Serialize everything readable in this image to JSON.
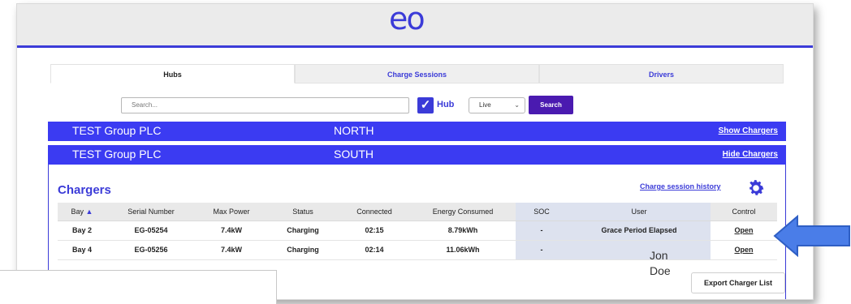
{
  "app": {
    "logo": "eo"
  },
  "tabs": [
    {
      "label": "Hubs"
    },
    {
      "label": "Charge Sessions"
    },
    {
      "label": "Drivers"
    }
  ],
  "search": {
    "placeholder": "Search...",
    "hub_label": "Hub",
    "hub_checked": true,
    "mode": "Live",
    "button": "Search"
  },
  "groups": [
    {
      "name": "TEST Group PLC",
      "region": "NORTH",
      "toggle": "Show Chargers"
    },
    {
      "name": "TEST Group PLC",
      "region": "SOUTH",
      "toggle": "Hide Chargers"
    }
  ],
  "chargers": {
    "title": "Chargers",
    "history_link": "Charge session history",
    "columns": [
      "Bay",
      "Serial Number",
      "Max Power",
      "Status",
      "Connected",
      "Energy Consumed",
      "SOC",
      "User",
      "Control"
    ],
    "rows": [
      {
        "bay": "Bay 2",
        "serial": "EG-05254",
        "power": "7.4kW",
        "status": "Charging",
        "connected": "02:15",
        "energy": "8.79kWh",
        "soc": "-",
        "user": "Grace Period Elapsed",
        "control": "Open"
      },
      {
        "bay": "Bay 4",
        "serial": "EG-05256",
        "power": "7.4kW",
        "status": "Charging",
        "connected": "02:14",
        "energy": "11.06kWh",
        "soc": "-",
        "user": "",
        "control": "Open"
      }
    ],
    "annotation_name": [
      "Jon",
      "Doe"
    ],
    "export_button": "Export Charger List"
  },
  "colors": {
    "accent": "#3b3bf2",
    "status_charging": "#1fa82d",
    "search_button": "#4a1ab0"
  }
}
